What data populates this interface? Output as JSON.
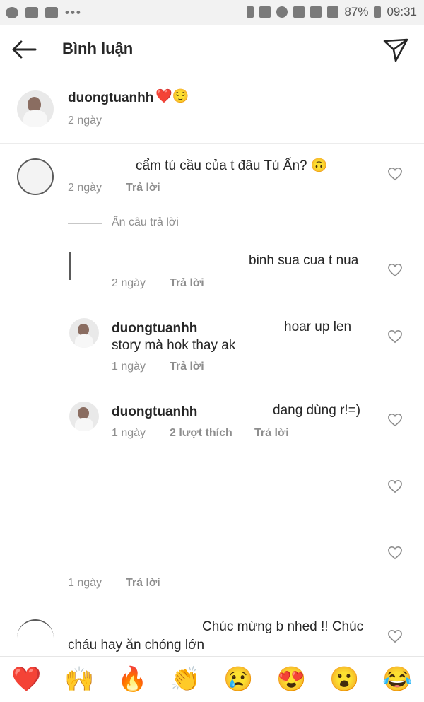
{
  "status_bar": {
    "battery": "87%",
    "time": "09:31"
  },
  "header": {
    "title": "Bình luận"
  },
  "caption": {
    "username": "duongtuanhh",
    "emojis": "❤️😌",
    "time": "2 ngày"
  },
  "comments": [
    {
      "text": "cẩm tú cầu của t đâu Tú Ấn? 🙃",
      "time": "2 ngày",
      "reply_label": "Trả lời"
    }
  ],
  "hide_replies_label": "Ẩn câu trả lời",
  "replies": [
    {
      "text": "binh sua cua t nua",
      "time": "2 ngày",
      "reply_label": "Trả lời"
    },
    {
      "username": "duongtuanhh",
      "text_line1": "hoar up len",
      "text_line2": "story mà hok thay ak",
      "time": "1 ngày",
      "reply_label": "Trả lời"
    },
    {
      "username": "duongtuanhh",
      "text": "dang dùng r!=)",
      "time": "1 ngày",
      "likes": "2 lượt thích",
      "reply_label": "Trả lời"
    }
  ],
  "hidden_comment": {
    "time": "1 ngày",
    "reply_label": "Trả lời"
  },
  "last_comment": {
    "text_line1": "Chúc mừng b nhed !! Chúc",
    "text_line2": "cháu hay ăn chóng lớn"
  },
  "reactions": [
    "❤️",
    "🙌",
    "🔥",
    "👏",
    "😢",
    "😍",
    "😮",
    "😂"
  ]
}
